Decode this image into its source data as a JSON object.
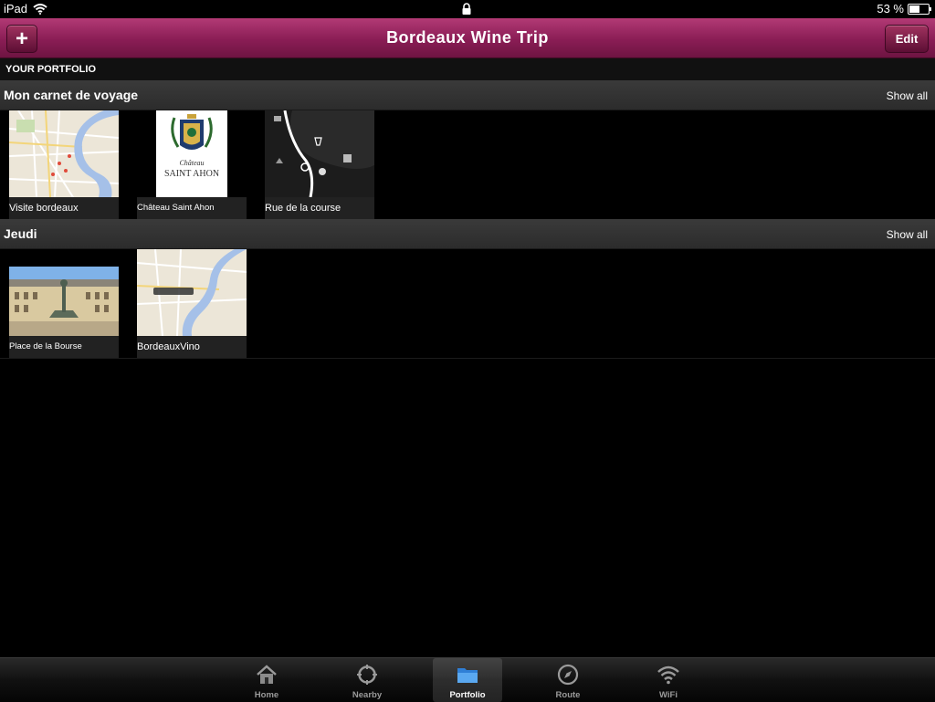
{
  "status_bar": {
    "device": "iPad",
    "battery": "53 %",
    "battery_level": 0.53
  },
  "nav": {
    "title": "Bordeaux Wine Trip",
    "add_label": "+",
    "edit_label": "Edit"
  },
  "portfolio_label": "YOUR PORTFOLIO",
  "sections": [
    {
      "title": "Mon carnet de voyage",
      "show_all": "Show all",
      "items": [
        {
          "caption": "Visite bordeaux",
          "kind": "map"
        },
        {
          "caption": "Château Saint Ahon",
          "kind": "logo",
          "logo_top": "Château",
          "logo_bottom": "SAINT AHON"
        },
        {
          "caption": "Rue de la course",
          "kind": "dark-map"
        }
      ]
    },
    {
      "title": "Jeudi",
      "show_all": "Show all",
      "items": [
        {
          "caption": "Place de la Bourse",
          "kind": "photo"
        },
        {
          "caption": "BordeauxVino",
          "kind": "map"
        }
      ]
    }
  ],
  "tabs": [
    {
      "label": "Home",
      "icon": "home-icon",
      "active": false
    },
    {
      "label": "Nearby",
      "icon": "crosshair-icon",
      "active": false
    },
    {
      "label": "Portfolio",
      "icon": "folder-icon",
      "active": true
    },
    {
      "label": "Route",
      "icon": "compass-icon",
      "active": false
    },
    {
      "label": "WiFi",
      "icon": "wifi-icon",
      "active": false
    }
  ],
  "colors": {
    "nav_accent": "#8a1d55",
    "tab_active_icon": "#3a8fe0"
  }
}
